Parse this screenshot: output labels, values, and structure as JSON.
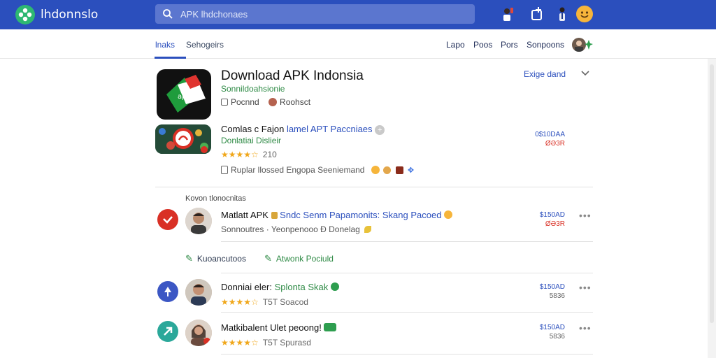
{
  "header": {
    "brand": "lhdonnslo",
    "search_placeholder": "APK lhdchonaes"
  },
  "nav": {
    "tabs": [
      "lnaks",
      "Sehogeirs"
    ],
    "links": [
      "Lapo",
      "Poos",
      "Pors",
      "Sonpoons"
    ]
  },
  "app": {
    "title": "Download APK Indonsia",
    "subtitle": "Sonnildoahsionie",
    "meta_1": "Pocnnd",
    "meta_2": "Roohsct",
    "expand_label": "Exige dand"
  },
  "featured": {
    "title_black": "Comlas c Fajon",
    "title_blue": "lamel APT Paccniaes",
    "subtitle": "Donlatiai Dislieir",
    "rating": "★★★★☆",
    "rating_count": "210",
    "note": "Ruplar llossed Engopa Seeniemand",
    "price": "0$10DAA",
    "price_sub": "ØƏ3R"
  },
  "section_label": "Kovon tlonocnitas",
  "rows": [
    {
      "title_black": "Matlatt APK",
      "title_blue": "Sndc Senm Papamonits: Skang Pacoed",
      "subtitle": "Sonnoutres · Yeonpenooo Ð Donelag",
      "price": "$150AD",
      "price_sub": "ØƏ3R"
    },
    {
      "title_black": "Donniai eler:",
      "title_green": "Splonta Skak",
      "rating": "★★★★☆",
      "rating_count": "T5T Soacod",
      "price": "$150AD",
      "price_sub": "5836"
    },
    {
      "title_black": "Matkibalent Ulet peoong!",
      "rating": "★★★★☆",
      "rating_count": "T5T Spurasd",
      "price": "$150AD",
      "price_sub": "5836"
    }
  ],
  "actions": {
    "link_1": "Kuoancutoos",
    "link_2": "Atwonk Pociuld"
  },
  "colors": {
    "header_bg": "#2b4fbd",
    "accent_blue": "#2b4fbd",
    "green": "#2e8a45",
    "red": "#d93025"
  }
}
